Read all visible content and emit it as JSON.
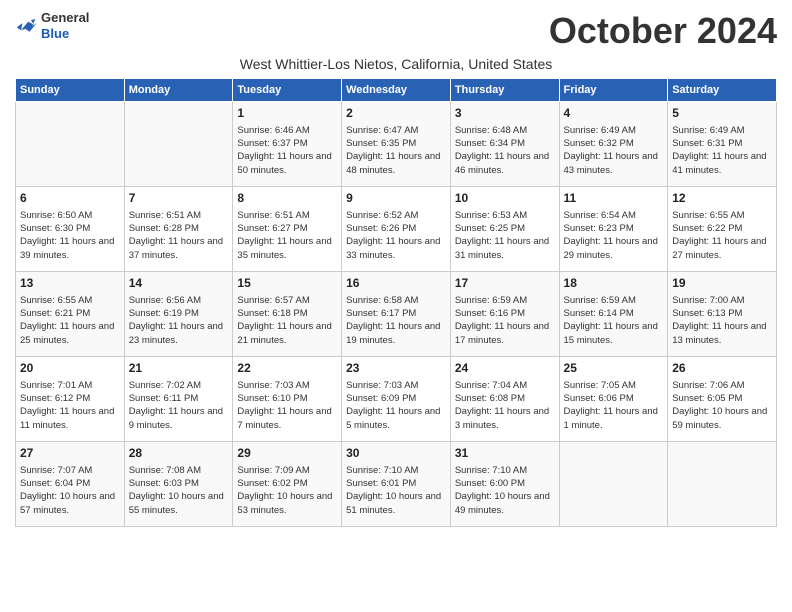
{
  "header": {
    "logo_line1": "General",
    "logo_line2": "Blue",
    "month_title": "October 2024",
    "subtitle": "West Whittier-Los Nietos, California, United States"
  },
  "days_of_week": [
    "Sunday",
    "Monday",
    "Tuesday",
    "Wednesday",
    "Thursday",
    "Friday",
    "Saturday"
  ],
  "weeks": [
    [
      {
        "day": "",
        "info": ""
      },
      {
        "day": "",
        "info": ""
      },
      {
        "day": "1",
        "info": "Sunrise: 6:46 AM\nSunset: 6:37 PM\nDaylight: 11 hours and 50 minutes."
      },
      {
        "day": "2",
        "info": "Sunrise: 6:47 AM\nSunset: 6:35 PM\nDaylight: 11 hours and 48 minutes."
      },
      {
        "day": "3",
        "info": "Sunrise: 6:48 AM\nSunset: 6:34 PM\nDaylight: 11 hours and 46 minutes."
      },
      {
        "day": "4",
        "info": "Sunrise: 6:49 AM\nSunset: 6:32 PM\nDaylight: 11 hours and 43 minutes."
      },
      {
        "day": "5",
        "info": "Sunrise: 6:49 AM\nSunset: 6:31 PM\nDaylight: 11 hours and 41 minutes."
      }
    ],
    [
      {
        "day": "6",
        "info": "Sunrise: 6:50 AM\nSunset: 6:30 PM\nDaylight: 11 hours and 39 minutes."
      },
      {
        "day": "7",
        "info": "Sunrise: 6:51 AM\nSunset: 6:28 PM\nDaylight: 11 hours and 37 minutes."
      },
      {
        "day": "8",
        "info": "Sunrise: 6:51 AM\nSunset: 6:27 PM\nDaylight: 11 hours and 35 minutes."
      },
      {
        "day": "9",
        "info": "Sunrise: 6:52 AM\nSunset: 6:26 PM\nDaylight: 11 hours and 33 minutes."
      },
      {
        "day": "10",
        "info": "Sunrise: 6:53 AM\nSunset: 6:25 PM\nDaylight: 11 hours and 31 minutes."
      },
      {
        "day": "11",
        "info": "Sunrise: 6:54 AM\nSunset: 6:23 PM\nDaylight: 11 hours and 29 minutes."
      },
      {
        "day": "12",
        "info": "Sunrise: 6:55 AM\nSunset: 6:22 PM\nDaylight: 11 hours and 27 minutes."
      }
    ],
    [
      {
        "day": "13",
        "info": "Sunrise: 6:55 AM\nSunset: 6:21 PM\nDaylight: 11 hours and 25 minutes."
      },
      {
        "day": "14",
        "info": "Sunrise: 6:56 AM\nSunset: 6:19 PM\nDaylight: 11 hours and 23 minutes."
      },
      {
        "day": "15",
        "info": "Sunrise: 6:57 AM\nSunset: 6:18 PM\nDaylight: 11 hours and 21 minutes."
      },
      {
        "day": "16",
        "info": "Sunrise: 6:58 AM\nSunset: 6:17 PM\nDaylight: 11 hours and 19 minutes."
      },
      {
        "day": "17",
        "info": "Sunrise: 6:59 AM\nSunset: 6:16 PM\nDaylight: 11 hours and 17 minutes."
      },
      {
        "day": "18",
        "info": "Sunrise: 6:59 AM\nSunset: 6:14 PM\nDaylight: 11 hours and 15 minutes."
      },
      {
        "day": "19",
        "info": "Sunrise: 7:00 AM\nSunset: 6:13 PM\nDaylight: 11 hours and 13 minutes."
      }
    ],
    [
      {
        "day": "20",
        "info": "Sunrise: 7:01 AM\nSunset: 6:12 PM\nDaylight: 11 hours and 11 minutes."
      },
      {
        "day": "21",
        "info": "Sunrise: 7:02 AM\nSunset: 6:11 PM\nDaylight: 11 hours and 9 minutes."
      },
      {
        "day": "22",
        "info": "Sunrise: 7:03 AM\nSunset: 6:10 PM\nDaylight: 11 hours and 7 minutes."
      },
      {
        "day": "23",
        "info": "Sunrise: 7:03 AM\nSunset: 6:09 PM\nDaylight: 11 hours and 5 minutes."
      },
      {
        "day": "24",
        "info": "Sunrise: 7:04 AM\nSunset: 6:08 PM\nDaylight: 11 hours and 3 minutes."
      },
      {
        "day": "25",
        "info": "Sunrise: 7:05 AM\nSunset: 6:06 PM\nDaylight: 11 hours and 1 minute."
      },
      {
        "day": "26",
        "info": "Sunrise: 7:06 AM\nSunset: 6:05 PM\nDaylight: 10 hours and 59 minutes."
      }
    ],
    [
      {
        "day": "27",
        "info": "Sunrise: 7:07 AM\nSunset: 6:04 PM\nDaylight: 10 hours and 57 minutes."
      },
      {
        "day": "28",
        "info": "Sunrise: 7:08 AM\nSunset: 6:03 PM\nDaylight: 10 hours and 55 minutes."
      },
      {
        "day": "29",
        "info": "Sunrise: 7:09 AM\nSunset: 6:02 PM\nDaylight: 10 hours and 53 minutes."
      },
      {
        "day": "30",
        "info": "Sunrise: 7:10 AM\nSunset: 6:01 PM\nDaylight: 10 hours and 51 minutes."
      },
      {
        "day": "31",
        "info": "Sunrise: 7:10 AM\nSunset: 6:00 PM\nDaylight: 10 hours and 49 minutes."
      },
      {
        "day": "",
        "info": ""
      },
      {
        "day": "",
        "info": ""
      }
    ]
  ]
}
